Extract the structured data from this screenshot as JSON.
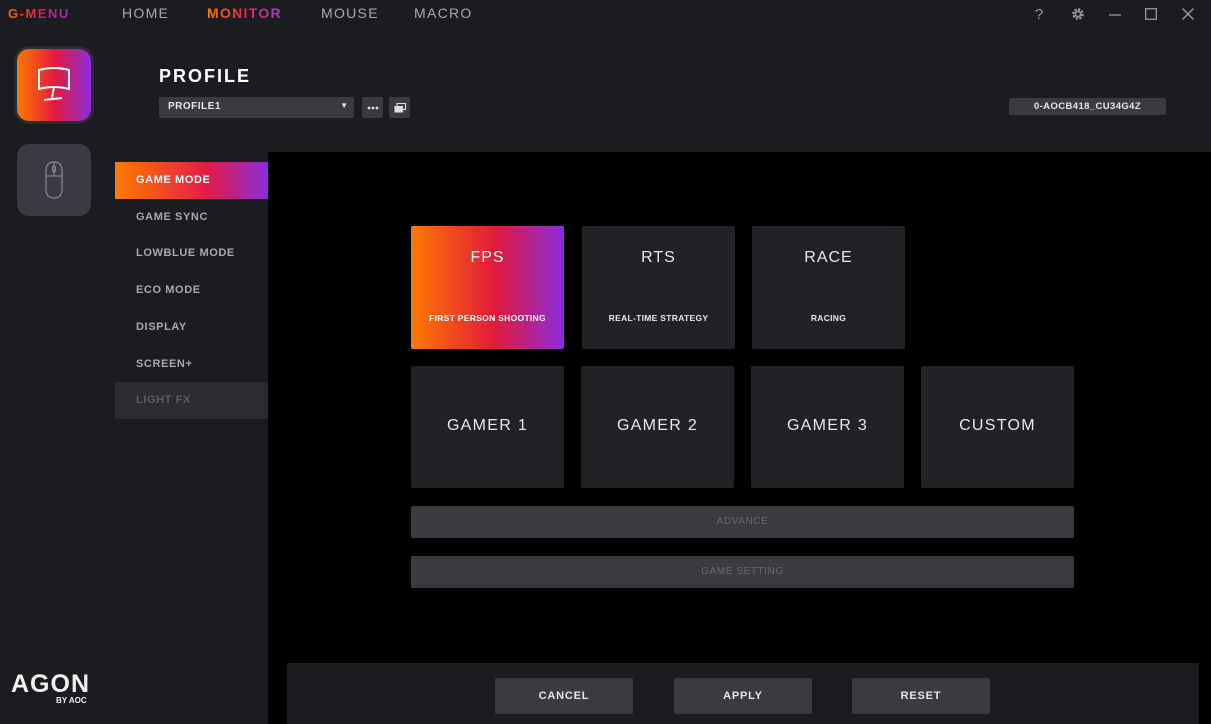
{
  "app": {
    "brand": "G-MENU"
  },
  "nav": [
    {
      "label": "HOME",
      "active": false
    },
    {
      "label": "MONITOR",
      "active": true
    },
    {
      "label": "MOUSE",
      "active": false
    },
    {
      "label": "MACRO",
      "active": false
    }
  ],
  "window_controls": {
    "help": "?"
  },
  "rail": {
    "devices": [
      {
        "name": "monitor",
        "icon": "monitor-icon",
        "selected": true
      },
      {
        "name": "mouse",
        "icon": "mouse-icon",
        "selected": false
      }
    ],
    "logo": {
      "big": "AGON",
      "small": "BY AOC"
    }
  },
  "header": {
    "title": "PROFILE",
    "profile_select": "PROFILE1",
    "serial": "0-AOCB418_CU34G4Z"
  },
  "menu": [
    {
      "label": "GAME MODE",
      "state": "active"
    },
    {
      "label": "GAME SYNC",
      "state": "normal"
    },
    {
      "label": "LOWBLUE MODE",
      "state": "normal"
    },
    {
      "label": "ECO MODE",
      "state": "normal"
    },
    {
      "label": "DISPLAY",
      "state": "normal"
    },
    {
      "label": "SCREEN+",
      "state": "normal"
    },
    {
      "label": "LIGHT FX",
      "state": "disabled"
    }
  ],
  "modes": {
    "top": [
      {
        "title": "FPS",
        "subtitle": "FIRST PERSON SHOOTING",
        "selected": true
      },
      {
        "title": "RTS",
        "subtitle": "REAL-TIME STRATEGY",
        "selected": false
      },
      {
        "title": "RACE",
        "subtitle": "RACING",
        "selected": false
      }
    ],
    "bottom": [
      {
        "title": "GAMER 1"
      },
      {
        "title": "GAMER 2"
      },
      {
        "title": "GAMER 3"
      },
      {
        "title": "CUSTOM"
      }
    ]
  },
  "advance_label": "ADVANCE",
  "game_setting_label": "GAME SETTING",
  "footer": {
    "cancel": "CANCEL",
    "apply": "APPLY",
    "reset": "RESET"
  },
  "colors": {
    "accent_start": "#ff7a00",
    "accent_mid": "#e01a3c",
    "accent_end": "#8a2ddc",
    "panel": "#1b1c20",
    "tile": "#212226"
  }
}
